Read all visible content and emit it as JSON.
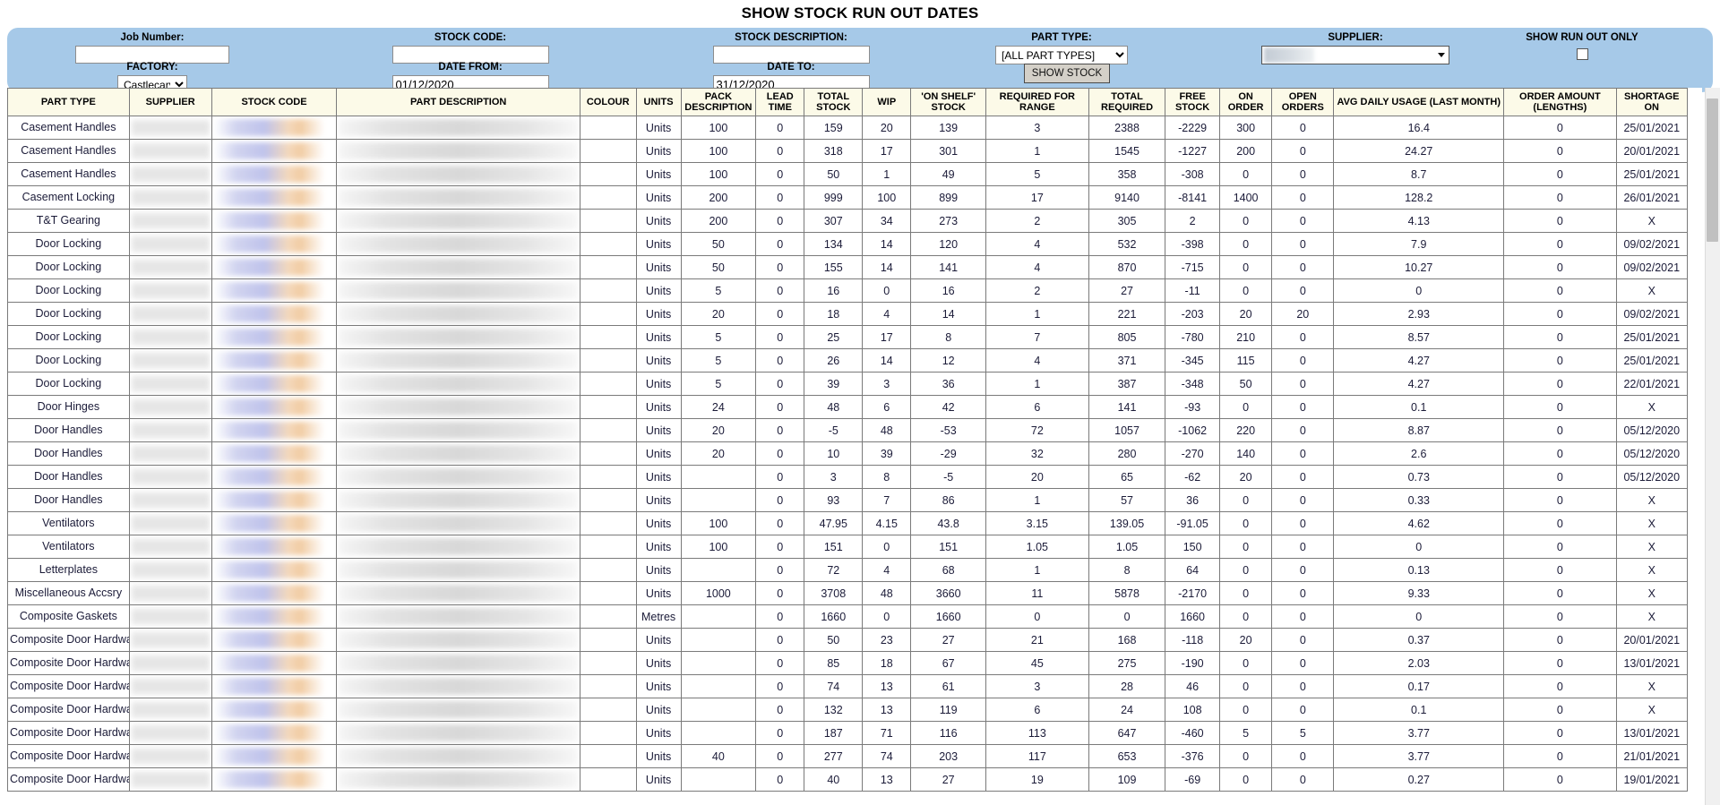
{
  "header": {
    "title": "SHOW STOCK RUN OUT DATES"
  },
  "filters": {
    "job_number": {
      "label": "Job Number:",
      "value": "",
      "placeholder": ""
    },
    "factory": {
      "label": "FACTORY:",
      "value": "Castlecary",
      "options": [
        "Castlecary"
      ]
    },
    "stock_code": {
      "label": "STOCK CODE:",
      "value": "",
      "placeholder": ""
    },
    "date_from": {
      "label": "DATE FROM:",
      "value": "01/12/2020"
    },
    "stock_description": {
      "label": "STOCK DESCRIPTION:",
      "value": "",
      "placeholder": ""
    },
    "date_to": {
      "label": "DATE TO:",
      "value": "31/12/2020"
    },
    "part_type": {
      "label": "PART TYPE:",
      "value": "[ALL PART TYPES]",
      "options": [
        "[ALL PART TYPES]"
      ]
    },
    "supplier": {
      "label": "SUPPLIER:",
      "value": ""
    },
    "show_run_out_only": {
      "label": "SHOW RUN OUT ONLY",
      "checked": false
    },
    "show_stock_button": "SHOW STOCK",
    "panel_color": "#a6c9e8"
  },
  "table": {
    "columns": [
      "PART TYPE",
      "SUPPLIER",
      "STOCK CODE",
      "PART DESCRIPTION",
      "COLOUR",
      "UNITS",
      "PACK DESCRIPTION",
      "LEAD TIME",
      "TOTAL STOCK",
      "WIP",
      "'ON SHELF' STOCK",
      "REQUIRED FOR RANGE",
      "TOTAL REQUIRED",
      "FREE STOCK",
      "ON ORDER",
      "OPEN ORDERS",
      "AVG DAILY USAGE (LAST MONTH)",
      "ORDER AMOUNT (LENGTHS)",
      "SHORTAGE ON"
    ],
    "danger_color": "#ef0000",
    "rows": [
      {
        "part_type": "Casement Handles",
        "colour": "",
        "units": "Units",
        "pack": "100",
        "lead": "0",
        "total_stock": "159",
        "wip": "20",
        "on_shelf": "139",
        "req_range": "3",
        "total_req": "2388",
        "free_stock": "-2229",
        "on_order": "300",
        "open_orders": "0",
        "avg_daily": "16.4",
        "order_amount": "0",
        "shortage_on": "25/01/2021",
        "danger": false
      },
      {
        "part_type": "Casement Handles",
        "colour": "",
        "units": "Units",
        "pack": "100",
        "lead": "0",
        "total_stock": "318",
        "wip": "17",
        "on_shelf": "301",
        "req_range": "1",
        "total_req": "1545",
        "free_stock": "-1227",
        "on_order": "200",
        "open_orders": "0",
        "avg_daily": "24.27",
        "order_amount": "0",
        "shortage_on": "20/01/2021",
        "danger": false
      },
      {
        "part_type": "Casement Handles",
        "colour": "",
        "units": "Units",
        "pack": "100",
        "lead": "0",
        "total_stock": "50",
        "wip": "1",
        "on_shelf": "49",
        "req_range": "5",
        "total_req": "358",
        "free_stock": "-308",
        "on_order": "0",
        "open_orders": "0",
        "avg_daily": "8.7",
        "order_amount": "0",
        "shortage_on": "25/01/2021",
        "danger": false
      },
      {
        "part_type": "Casement Locking",
        "colour": "",
        "units": "Units",
        "pack": "200",
        "lead": "0",
        "total_stock": "999",
        "wip": "100",
        "on_shelf": "899",
        "req_range": "17",
        "total_req": "9140",
        "free_stock": "-8141",
        "on_order": "1400",
        "open_orders": "0",
        "avg_daily": "128.2",
        "order_amount": "0",
        "shortage_on": "26/01/2021",
        "danger": false
      },
      {
        "part_type": "T&T Gearing",
        "colour": "",
        "units": "Units",
        "pack": "200",
        "lead": "0",
        "total_stock": "307",
        "wip": "34",
        "on_shelf": "273",
        "req_range": "2",
        "total_req": "305",
        "free_stock": "2",
        "on_order": "0",
        "open_orders": "0",
        "avg_daily": "4.13",
        "order_amount": "0",
        "shortage_on": "X",
        "danger": false
      },
      {
        "part_type": "Door Locking",
        "colour": "",
        "units": "Units",
        "pack": "50",
        "lead": "0",
        "total_stock": "134",
        "wip": "14",
        "on_shelf": "120",
        "req_range": "4",
        "total_req": "532",
        "free_stock": "-398",
        "on_order": "0",
        "open_orders": "0",
        "avg_daily": "7.9",
        "order_amount": "0",
        "shortage_on": "09/02/2021",
        "danger": false
      },
      {
        "part_type": "Door Locking",
        "colour": "",
        "units": "Units",
        "pack": "50",
        "lead": "0",
        "total_stock": "155",
        "wip": "14",
        "on_shelf": "141",
        "req_range": "4",
        "total_req": "870",
        "free_stock": "-715",
        "on_order": "0",
        "open_orders": "0",
        "avg_daily": "10.27",
        "order_amount": "0",
        "shortage_on": "09/02/2021",
        "danger": false
      },
      {
        "part_type": "Door Locking",
        "colour": "",
        "units": "Units",
        "pack": "5",
        "lead": "0",
        "total_stock": "16",
        "wip": "0",
        "on_shelf": "16",
        "req_range": "2",
        "total_req": "27",
        "free_stock": "-11",
        "on_order": "0",
        "open_orders": "0",
        "avg_daily": "0",
        "order_amount": "0",
        "shortage_on": "X",
        "danger": false
      },
      {
        "part_type": "Door Locking",
        "colour": "",
        "units": "Units",
        "pack": "20",
        "lead": "0",
        "total_stock": "18",
        "wip": "4",
        "on_shelf": "14",
        "req_range": "1",
        "total_req": "221",
        "free_stock": "-203",
        "on_order": "20",
        "open_orders": "20",
        "avg_daily": "2.93",
        "order_amount": "0",
        "shortage_on": "09/02/2021",
        "danger": false
      },
      {
        "part_type": "Door Locking",
        "colour": "",
        "units": "Units",
        "pack": "5",
        "lead": "0",
        "total_stock": "25",
        "wip": "17",
        "on_shelf": "8",
        "req_range": "7",
        "total_req": "805",
        "free_stock": "-780",
        "on_order": "210",
        "open_orders": "0",
        "avg_daily": "8.57",
        "order_amount": "0",
        "shortage_on": "25/01/2021",
        "danger": false
      },
      {
        "part_type": "Door Locking",
        "colour": "",
        "units": "Units",
        "pack": "5",
        "lead": "0",
        "total_stock": "26",
        "wip": "14",
        "on_shelf": "12",
        "req_range": "4",
        "total_req": "371",
        "free_stock": "-345",
        "on_order": "115",
        "open_orders": "0",
        "avg_daily": "4.27",
        "order_amount": "0",
        "shortage_on": "25/01/2021",
        "danger": false
      },
      {
        "part_type": "Door Locking",
        "colour": "",
        "units": "Units",
        "pack": "5",
        "lead": "0",
        "total_stock": "39",
        "wip": "3",
        "on_shelf": "36",
        "req_range": "1",
        "total_req": "387",
        "free_stock": "-348",
        "on_order": "50",
        "open_orders": "0",
        "avg_daily": "4.27",
        "order_amount": "0",
        "shortage_on": "22/01/2021",
        "danger": false
      },
      {
        "part_type": "Door Hinges",
        "colour": "",
        "units": "Units",
        "pack": "24",
        "lead": "0",
        "total_stock": "48",
        "wip": "6",
        "on_shelf": "42",
        "req_range": "6",
        "total_req": "141",
        "free_stock": "-93",
        "on_order": "0",
        "open_orders": "0",
        "avg_daily": "0.1",
        "order_amount": "0",
        "shortage_on": "X",
        "danger": false
      },
      {
        "part_type": "Door Handles",
        "colour": "",
        "units": "Units",
        "pack": "20",
        "lead": "0",
        "total_stock": "-5",
        "wip": "48",
        "on_shelf": "-53",
        "req_range": "72",
        "total_req": "1057",
        "free_stock": "-1062",
        "on_order": "220",
        "open_orders": "0",
        "avg_daily": "8.87",
        "order_amount": "0",
        "shortage_on": "05/12/2020",
        "danger": true
      },
      {
        "part_type": "Door Handles",
        "colour": "",
        "units": "Units",
        "pack": "20",
        "lead": "0",
        "total_stock": "10",
        "wip": "39",
        "on_shelf": "-29",
        "req_range": "32",
        "total_req": "280",
        "free_stock": "-270",
        "on_order": "140",
        "open_orders": "0",
        "avg_daily": "2.6",
        "order_amount": "0",
        "shortage_on": "05/12/2020",
        "danger": true
      },
      {
        "part_type": "Door Handles",
        "colour": "",
        "units": "Units",
        "pack": "",
        "lead": "0",
        "total_stock": "3",
        "wip": "8",
        "on_shelf": "-5",
        "req_range": "20",
        "total_req": "65",
        "free_stock": "-62",
        "on_order": "20",
        "open_orders": "0",
        "avg_daily": "0.73",
        "order_amount": "0",
        "shortage_on": "05/12/2020",
        "danger": true
      },
      {
        "part_type": "Door Handles",
        "colour": "",
        "units": "Units",
        "pack": "",
        "lead": "0",
        "total_stock": "93",
        "wip": "7",
        "on_shelf": "86",
        "req_range": "1",
        "total_req": "57",
        "free_stock": "36",
        "on_order": "0",
        "open_orders": "0",
        "avg_daily": "0.33",
        "order_amount": "0",
        "shortage_on": "X",
        "danger": false
      },
      {
        "part_type": "Ventilators",
        "colour": "",
        "units": "Units",
        "pack": "100",
        "lead": "0",
        "total_stock": "47.95",
        "wip": "4.15",
        "on_shelf": "43.8",
        "req_range": "3.15",
        "total_req": "139.05",
        "free_stock": "-91.05",
        "on_order": "0",
        "open_orders": "0",
        "avg_daily": "4.62",
        "order_amount": "0",
        "shortage_on": "X",
        "danger": false
      },
      {
        "part_type": "Ventilators",
        "colour": "",
        "units": "Units",
        "pack": "100",
        "lead": "0",
        "total_stock": "151",
        "wip": "0",
        "on_shelf": "151",
        "req_range": "1.05",
        "total_req": "1.05",
        "free_stock": "150",
        "on_order": "0",
        "open_orders": "0",
        "avg_daily": "0",
        "order_amount": "0",
        "shortage_on": "X",
        "danger": false
      },
      {
        "part_type": "Letterplates",
        "colour": "",
        "units": "Units",
        "pack": "",
        "lead": "0",
        "total_stock": "72",
        "wip": "4",
        "on_shelf": "68",
        "req_range": "1",
        "total_req": "8",
        "free_stock": "64",
        "on_order": "0",
        "open_orders": "0",
        "avg_daily": "0.13",
        "order_amount": "0",
        "shortage_on": "X",
        "danger": false
      },
      {
        "part_type": "Miscellaneous Accsry",
        "colour": "",
        "units": "Units",
        "pack": "1000",
        "lead": "0",
        "total_stock": "3708",
        "wip": "48",
        "on_shelf": "3660",
        "req_range": "11",
        "total_req": "5878",
        "free_stock": "-2170",
        "on_order": "0",
        "open_orders": "0",
        "avg_daily": "9.33",
        "order_amount": "0",
        "shortage_on": "X",
        "danger": false
      },
      {
        "part_type": "Composite Gaskets",
        "colour": "",
        "units": "Metres",
        "pack": "",
        "lead": "0",
        "total_stock": "1660",
        "wip": "0",
        "on_shelf": "1660",
        "req_range": "0",
        "total_req": "0",
        "free_stock": "1660",
        "on_order": "0",
        "open_orders": "0",
        "avg_daily": "0",
        "order_amount": "0",
        "shortage_on": "X",
        "danger": false
      },
      {
        "part_type": "Composite Door Hardware",
        "colour": "",
        "units": "Units",
        "pack": "",
        "lead": "0",
        "total_stock": "50",
        "wip": "23",
        "on_shelf": "27",
        "req_range": "21",
        "total_req": "168",
        "free_stock": "-118",
        "on_order": "20",
        "open_orders": "0",
        "avg_daily": "0.37",
        "order_amount": "0",
        "shortage_on": "20/01/2021",
        "danger": false
      },
      {
        "part_type": "Composite Door Hardware",
        "colour": "",
        "units": "Units",
        "pack": "",
        "lead": "0",
        "total_stock": "85",
        "wip": "18",
        "on_shelf": "67",
        "req_range": "45",
        "total_req": "275",
        "free_stock": "-190",
        "on_order": "0",
        "open_orders": "0",
        "avg_daily": "2.03",
        "order_amount": "0",
        "shortage_on": "13/01/2021",
        "danger": false
      },
      {
        "part_type": "Composite Door Hardware",
        "colour": "",
        "units": "Units",
        "pack": "",
        "lead": "0",
        "total_stock": "74",
        "wip": "13",
        "on_shelf": "61",
        "req_range": "3",
        "total_req": "28",
        "free_stock": "46",
        "on_order": "0",
        "open_orders": "0",
        "avg_daily": "0.17",
        "order_amount": "0",
        "shortage_on": "X",
        "danger": false
      },
      {
        "part_type": "Composite Door Hardware",
        "colour": "",
        "units": "Units",
        "pack": "",
        "lead": "0",
        "total_stock": "132",
        "wip": "13",
        "on_shelf": "119",
        "req_range": "6",
        "total_req": "24",
        "free_stock": "108",
        "on_order": "0",
        "open_orders": "0",
        "avg_daily": "0.1",
        "order_amount": "0",
        "shortage_on": "X",
        "danger": false
      },
      {
        "part_type": "Composite Door Hardware",
        "colour": "",
        "units": "Units",
        "pack": "",
        "lead": "0",
        "total_stock": "187",
        "wip": "71",
        "on_shelf": "116",
        "req_range": "113",
        "total_req": "647",
        "free_stock": "-460",
        "on_order": "5",
        "open_orders": "5",
        "avg_daily": "3.77",
        "order_amount": "0",
        "shortage_on": "13/01/2021",
        "danger": false
      },
      {
        "part_type": "Composite Door Hardware",
        "colour": "",
        "units": "Units",
        "pack": "40",
        "lead": "0",
        "total_stock": "277",
        "wip": "74",
        "on_shelf": "203",
        "req_range": "117",
        "total_req": "653",
        "free_stock": "-376",
        "on_order": "0",
        "open_orders": "0",
        "avg_daily": "3.77",
        "order_amount": "0",
        "shortage_on": "21/01/2021",
        "danger": false
      },
      {
        "part_type": "Composite Door Hardware",
        "colour": "",
        "units": "Units",
        "pack": "",
        "lead": "0",
        "total_stock": "40",
        "wip": "13",
        "on_shelf": "27",
        "req_range": "19",
        "total_req": "109",
        "free_stock": "-69",
        "on_order": "0",
        "open_orders": "0",
        "avg_daily": "0.27",
        "order_amount": "0",
        "shortage_on": "19/01/2021",
        "danger": false
      }
    ]
  }
}
